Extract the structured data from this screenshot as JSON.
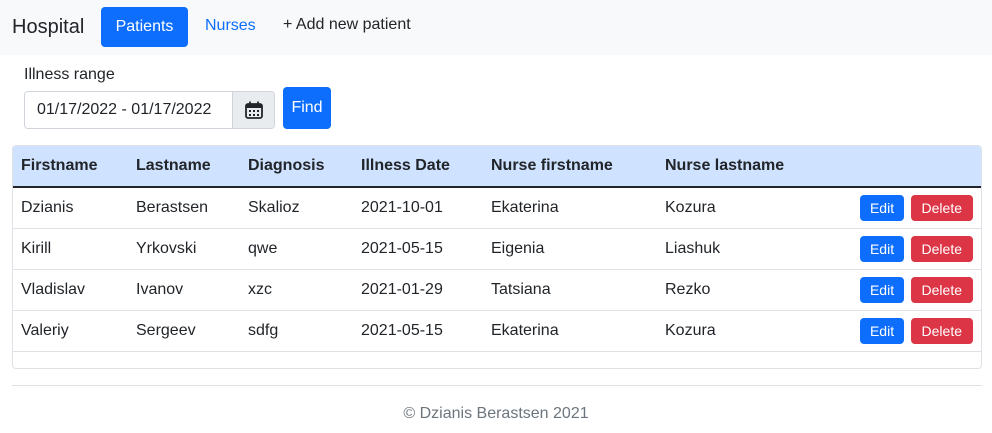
{
  "navbar": {
    "brand": "Hospital",
    "patients_label": "Patients",
    "nurses_label": "Nurses",
    "add_label": "+ Add new patient"
  },
  "filter": {
    "label": "Illness range",
    "date_range": "01/17/2022 - 01/17/2022",
    "find_label": "Find"
  },
  "table": {
    "headers": [
      "Firstname",
      "Lastname",
      "Diagnosis",
      "Illness Date",
      "Nurse firstname",
      "Nurse lastname"
    ],
    "edit_label": "Edit",
    "delete_label": "Delete",
    "rows": [
      [
        "Dzianis",
        "Berastsen",
        "Skalioz",
        "2021-10-01",
        "Ekaterina",
        "Kozura"
      ],
      [
        "Kirill",
        "Yrkovski",
        "qwe",
        "2021-05-15",
        "Eigenia",
        "Liashuk"
      ],
      [
        "Vladislav",
        "Ivanov",
        "xzc",
        "2021-01-29",
        "Tatsiana",
        "Rezko"
      ],
      [
        "Valeriy",
        "Sergeev",
        "sdfg",
        "2021-05-15",
        "Ekaterina",
        "Kozura"
      ]
    ]
  },
  "footer": {
    "text": "© Dzianis Berastsen 2021"
  },
  "colors": {
    "primary": "#0d6efd",
    "danger": "#dc3545",
    "table_header_bg": "#cfe2ff",
    "navbar_bg": "#f8f9fa"
  }
}
